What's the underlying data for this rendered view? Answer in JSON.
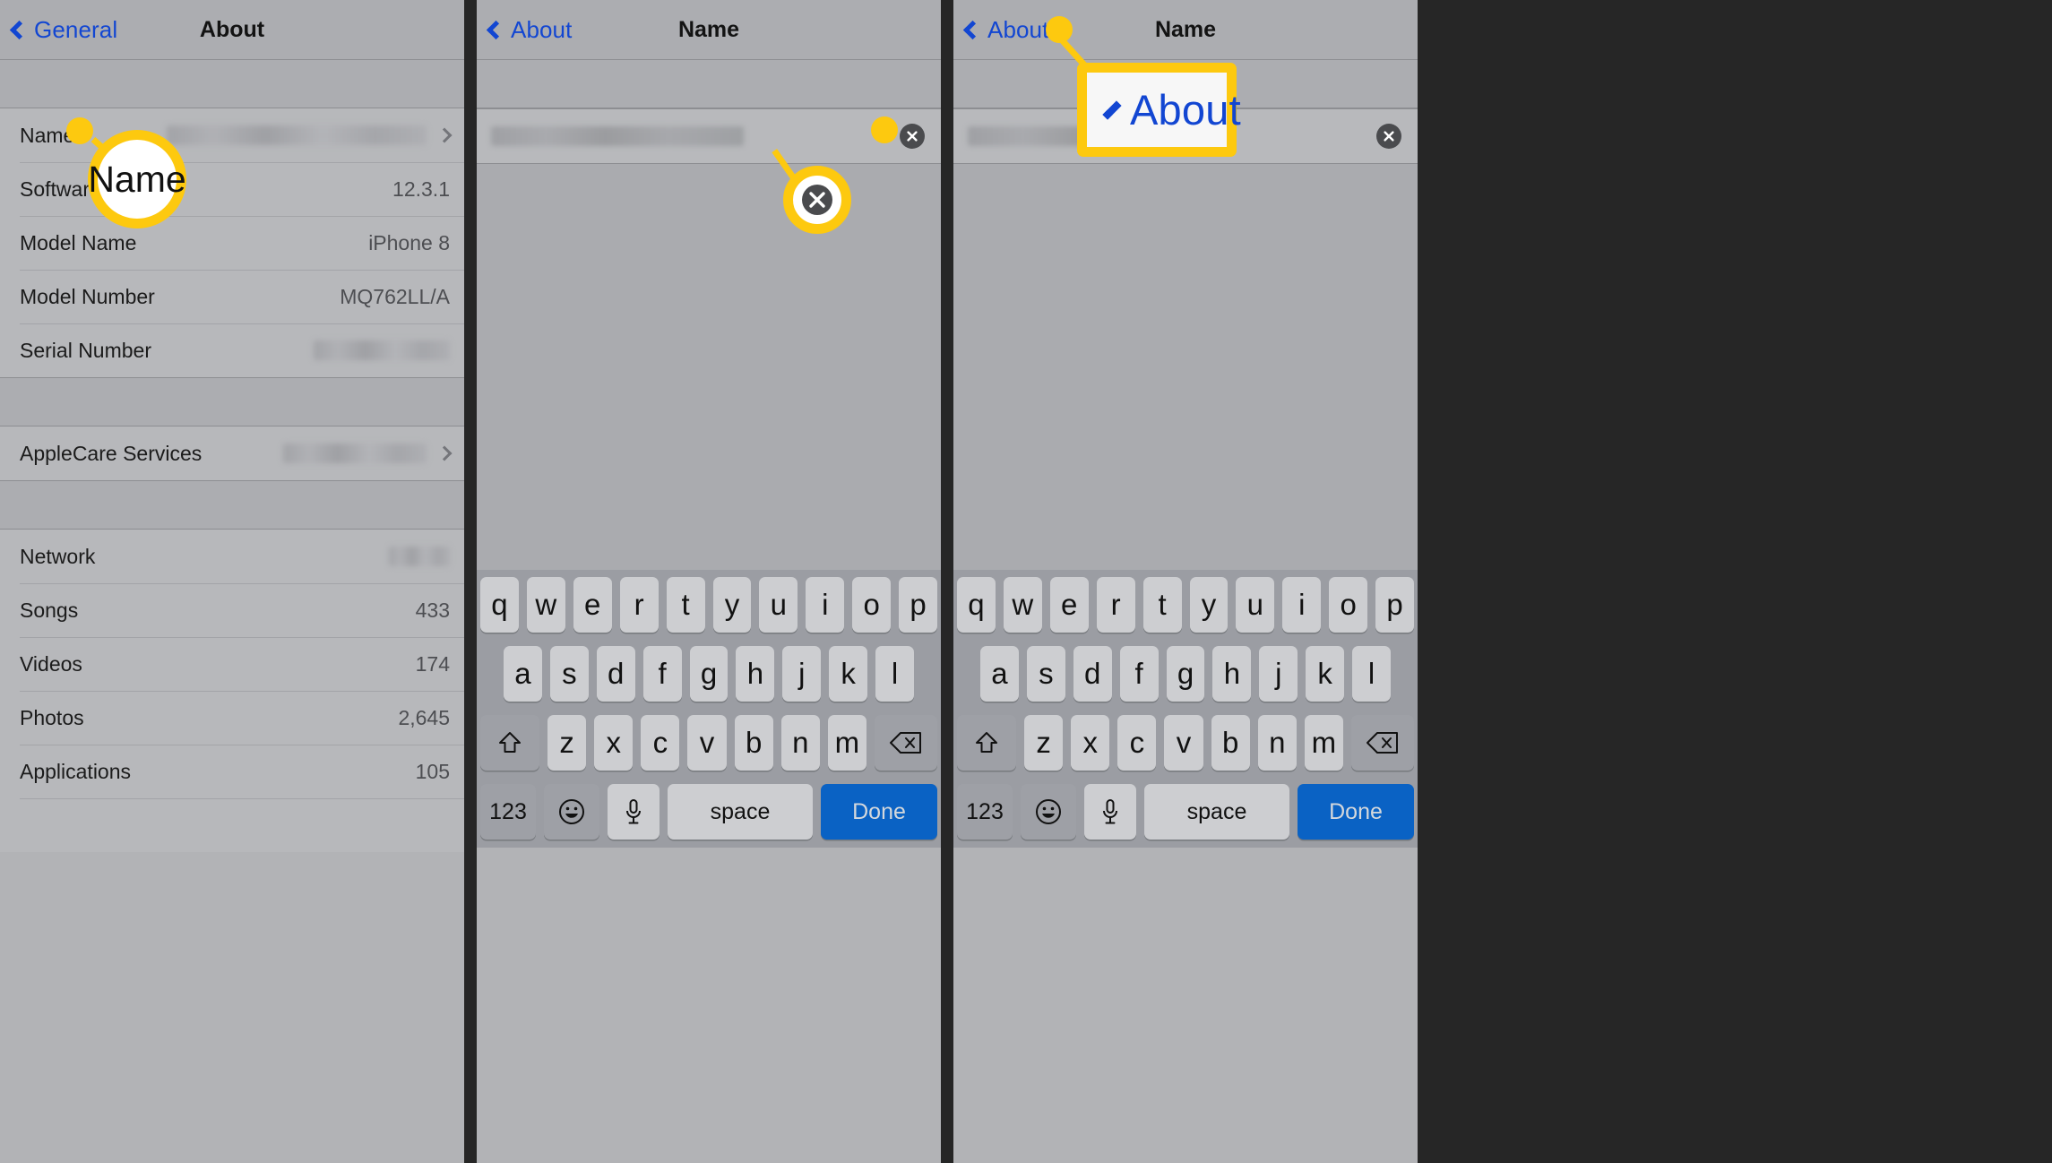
{
  "panels": [
    {
      "id": "about-screen",
      "navbar": {
        "back_label": "General",
        "title": "About"
      },
      "groups": [
        {
          "rows": [
            {
              "label": "Name",
              "value": "",
              "redacted": true,
              "chevron": true
            },
            {
              "label": "Software",
              "value": "12.3.1",
              "redacted": false,
              "chevron": false
            },
            {
              "label": "Model Name",
              "value": "iPhone 8",
              "redacted": false,
              "chevron": false
            },
            {
              "label": "Model Number",
              "value": "MQ762LL/A",
              "redacted": false,
              "chevron": false
            },
            {
              "label": "Serial Number",
              "value": "",
              "redacted": true,
              "chevron": false
            }
          ]
        },
        {
          "rows": [
            {
              "label": "AppleCare Services",
              "value": "",
              "redacted": true,
              "chevron": true
            }
          ]
        },
        {
          "rows": [
            {
              "label": "Network",
              "value": "",
              "redacted": true,
              "chevron": false
            },
            {
              "label": "Songs",
              "value": "433",
              "redacted": false,
              "chevron": false
            },
            {
              "label": "Videos",
              "value": "174",
              "redacted": false,
              "chevron": false
            },
            {
              "label": "Photos",
              "value": "2,645",
              "redacted": false,
              "chevron": false
            },
            {
              "label": "Applications",
              "value": "105",
              "redacted": false,
              "chevron": false
            }
          ]
        }
      ]
    },
    {
      "id": "name-edit-screen-middle",
      "navbar": {
        "back_label": "About",
        "title": "Name"
      },
      "field": {
        "value": "",
        "redacted": true,
        "clear_icon": "clear-circle-icon"
      }
    },
    {
      "id": "name-edit-screen-right",
      "navbar": {
        "back_label": "About",
        "title": "Name"
      },
      "field": {
        "value": "",
        "redacted": true,
        "clear_icon": "clear-circle-icon"
      }
    }
  ],
  "keyboard": {
    "row1": [
      "q",
      "w",
      "e",
      "r",
      "t",
      "y",
      "u",
      "i",
      "o",
      "p"
    ],
    "row2": [
      "a",
      "s",
      "d",
      "f",
      "g",
      "h",
      "j",
      "k",
      "l"
    ],
    "row3": [
      "z",
      "x",
      "c",
      "v",
      "b",
      "n",
      "m"
    ],
    "shift_icon": "shift-arrow-icon",
    "backspace_icon": "backspace-icon",
    "numbers_label": "123",
    "emoji_icon": "smiley-face-icon",
    "mic_icon": "microphone-icon",
    "space_label": "space",
    "done_label": "Done"
  },
  "callouts": [
    {
      "id": "callout-name-row",
      "text": "Name",
      "kind": "circle"
    },
    {
      "id": "callout-clear-button",
      "text": "",
      "kind": "circle-icon",
      "icon": "clear-circle-icon"
    },
    {
      "id": "callout-about-back",
      "text": "About",
      "kind": "box"
    }
  ],
  "colors": {
    "accent_yellow": "#fdc90f",
    "link_blue": "#1246d2",
    "done_blue": "#0a62c4",
    "panel_bg": "#b7b8bb",
    "navbar_bg": "#acadb1",
    "keyboard_bg": "#9b9da3"
  }
}
